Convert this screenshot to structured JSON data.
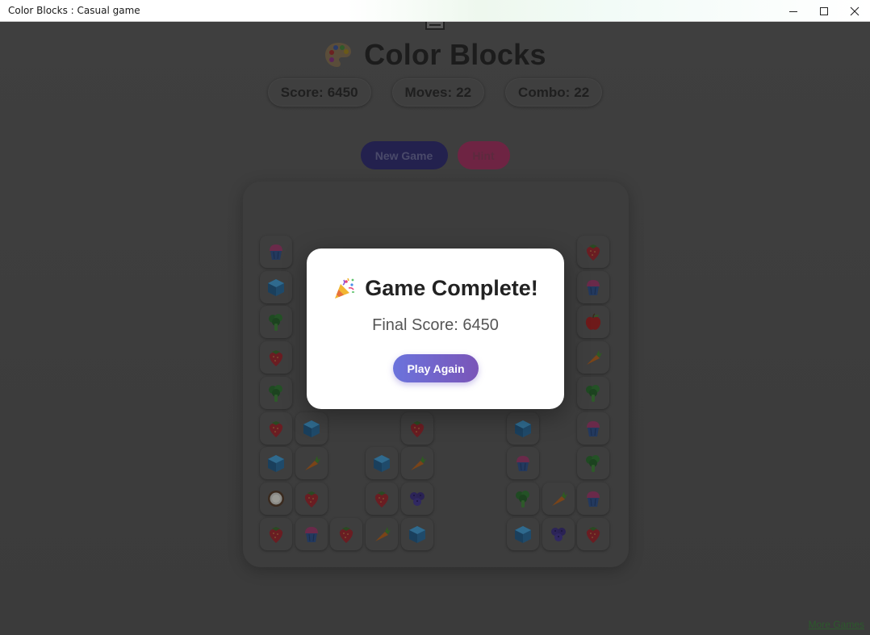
{
  "window": {
    "title": "Color Blocks : Casual game",
    "controls": [
      "minimize-icon",
      "maximize-icon",
      "close-icon"
    ]
  },
  "header": {
    "icon": "palette-icon",
    "title": "Color Blocks"
  },
  "stats": {
    "score_label": "Score:",
    "score_value": "6450",
    "moves_label": "Moves:",
    "moves_value": "22",
    "combo_label": "Combo:",
    "combo_value": "22"
  },
  "controls": {
    "new_game_label": "New Game",
    "hint_label": "Hint"
  },
  "board": {
    "columns": 10,
    "rows": 9,
    "pieces": [
      {
        "col": 0,
        "row": 0,
        "type": "cupcake"
      },
      {
        "col": 9,
        "row": 0,
        "type": "strawberry"
      },
      {
        "col": 0,
        "row": 1,
        "type": "cube"
      },
      {
        "col": 9,
        "row": 1,
        "type": "cupcake"
      },
      {
        "col": 0,
        "row": 2,
        "type": "broccoli"
      },
      {
        "col": 9,
        "row": 2,
        "type": "apple"
      },
      {
        "col": 0,
        "row": 3,
        "type": "strawberry"
      },
      {
        "col": 9,
        "row": 3,
        "type": "carrot"
      },
      {
        "col": 0,
        "row": 4,
        "type": "broccoli"
      },
      {
        "col": 9,
        "row": 4,
        "type": "broccoli"
      },
      {
        "col": 0,
        "row": 5,
        "type": "strawberry"
      },
      {
        "col": 1,
        "row": 5,
        "type": "cube"
      },
      {
        "col": 4,
        "row": 5,
        "type": "strawberry"
      },
      {
        "col": 7,
        "row": 5,
        "type": "cube"
      },
      {
        "col": 9,
        "row": 5,
        "type": "cupcake"
      },
      {
        "col": 0,
        "row": 6,
        "type": "cube"
      },
      {
        "col": 1,
        "row": 6,
        "type": "carrot"
      },
      {
        "col": 3,
        "row": 6,
        "type": "cube"
      },
      {
        "col": 4,
        "row": 6,
        "type": "carrot"
      },
      {
        "col": 7,
        "row": 6,
        "type": "cupcake"
      },
      {
        "col": 9,
        "row": 6,
        "type": "broccoli"
      },
      {
        "col": 0,
        "row": 7,
        "type": "coconut"
      },
      {
        "col": 1,
        "row": 7,
        "type": "strawberry"
      },
      {
        "col": 3,
        "row": 7,
        "type": "strawberry"
      },
      {
        "col": 4,
        "row": 7,
        "type": "blueberries"
      },
      {
        "col": 7,
        "row": 7,
        "type": "broccoli"
      },
      {
        "col": 8,
        "row": 7,
        "type": "carrot"
      },
      {
        "col": 9,
        "row": 7,
        "type": "cupcake"
      },
      {
        "col": 0,
        "row": 8,
        "type": "strawberry"
      },
      {
        "col": 1,
        "row": 8,
        "type": "cupcake"
      },
      {
        "col": 2,
        "row": 8,
        "type": "strawberry"
      },
      {
        "col": 3,
        "row": 8,
        "type": "carrot"
      },
      {
        "col": 4,
        "row": 8,
        "type": "cube"
      },
      {
        "col": 7,
        "row": 8,
        "type": "cube"
      },
      {
        "col": 8,
        "row": 8,
        "type": "blueberries"
      },
      {
        "col": 9,
        "row": 8,
        "type": "strawberry"
      }
    ]
  },
  "footer": {
    "more_games_label": "More Games"
  },
  "modal": {
    "icon": "party-popper-icon",
    "title": "Game Complete!",
    "final_score_label": "Final Score:",
    "final_score_value": "6450",
    "play_again_label": "Play Again"
  }
}
